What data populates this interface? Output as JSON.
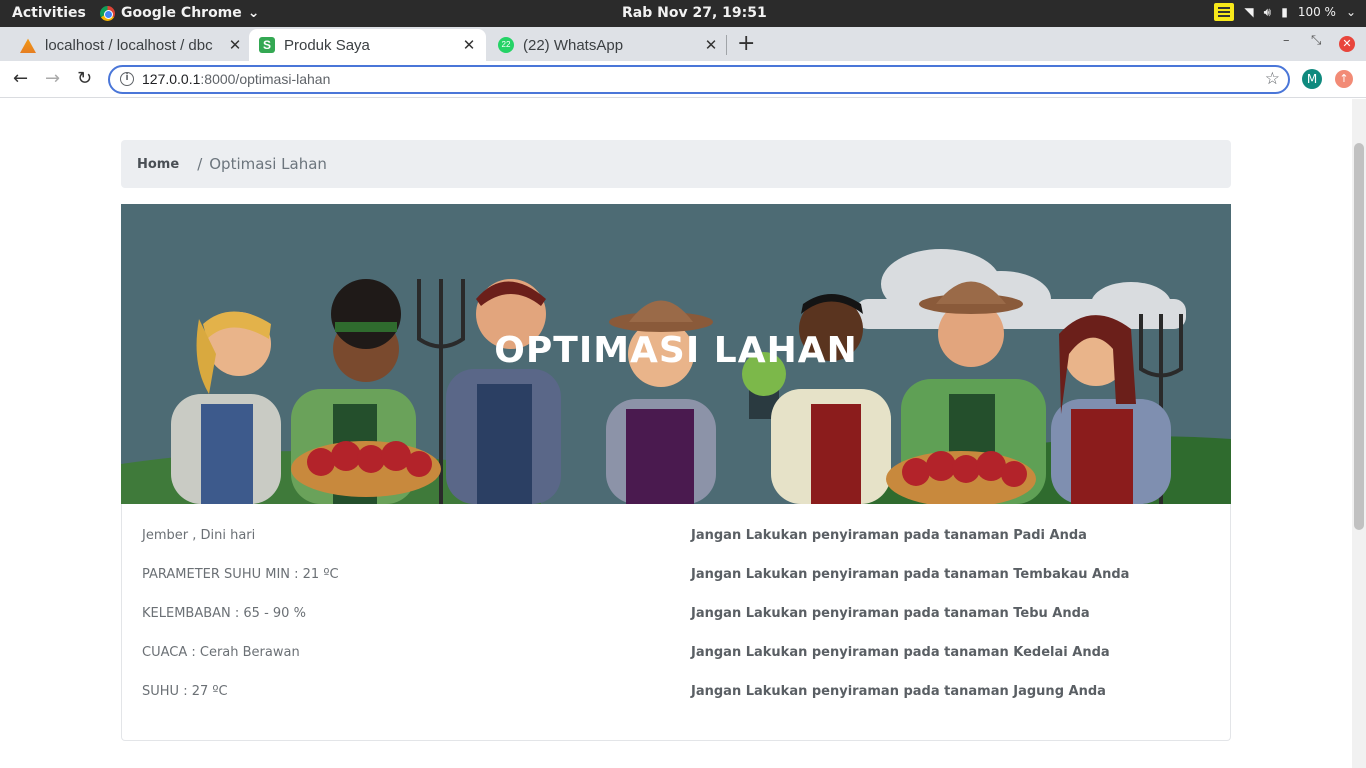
{
  "system": {
    "activities": "Activities",
    "app_name": "Google Chrome",
    "clock": "Rab Nov 27, 19:51",
    "battery": "100 %"
  },
  "browser": {
    "tabs": [
      {
        "title": "localhost / localhost / dbc",
        "active": false
      },
      {
        "title": "Produk Saya",
        "active": true
      },
      {
        "title": "(22) WhatsApp",
        "active": false
      }
    ],
    "whatsapp_badge": "22",
    "url_host": "127.0.0.1",
    "url_rest": ":8000/optimasi-lahan",
    "profile_initial": "M"
  },
  "page": {
    "breadcrumb": {
      "home": "Home",
      "separator": "/",
      "current": "Optimasi Lahan"
    },
    "hero_title": "OPTIMASI LAHAN",
    "info": [
      "Jember , Dini hari",
      "PARAMETER SUHU MIN : 21 ºC",
      "KELEMBABAN : 65 - 90 %",
      "CUACA : Cerah Berawan",
      "SUHU : 27 ºC"
    ],
    "recommendations": [
      "Jangan Lakukan penyiraman pada tanaman Padi Anda",
      "Jangan Lakukan penyiraman pada tanaman Tembakau Anda",
      "Jangan Lakukan penyiraman pada tanaman Tebu Anda",
      "Jangan Lakukan penyiraman pada tanaman Kedelai Anda",
      "Jangan Lakukan penyiraman pada tanaman Jagung Anda"
    ]
  },
  "colors": {
    "hero_bg": "#4d6b74",
    "omnibox_focus": "#4a76d8",
    "breadcrumb_bg": "#eceef1"
  }
}
